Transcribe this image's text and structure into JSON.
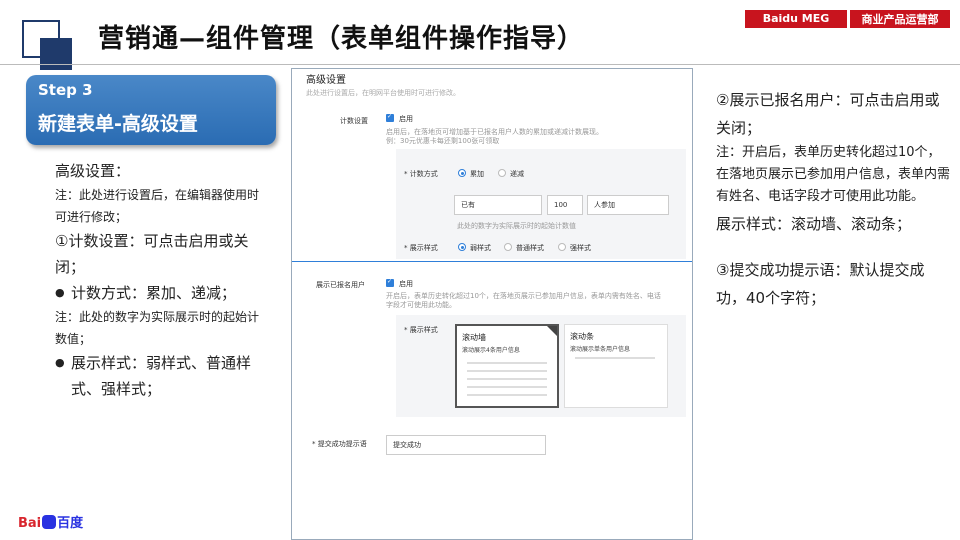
{
  "header": {
    "title": "营销通—组件管理（表单组件操作指导）",
    "tag1": "Baidu MEG",
    "tag2": "商业产品运营部"
  },
  "step": {
    "number": "Step 3",
    "title": "新建表单-高级设置"
  },
  "left_notes": {
    "l1": "高级设置：",
    "l2": "注：此处进行设置后，在编辑器使用时可进行修改；",
    "l3": "①计数设置：可点击启用或关闭；",
    "l4": "计数方式：累加、递减；",
    "l5": "注：此处的数字为实际展示时的起始计数值；",
    "l6": "展示样式：弱样式、普通样式、强样式；"
  },
  "panel": {
    "title": "高级设置",
    "subtitle": "此处进行设置后，在明网平台使用时可进行修改。",
    "count_label": "计数设置",
    "enable": "启用",
    "count_hint": "启用后，在落地页可增加基于已报名用户人数的累加或递减计数展现。",
    "count_example": "例：30元优惠卡每还剩100张可领取",
    "method_label": "* 计数方式",
    "method_opt1": "累加",
    "method_opt2": "递减",
    "input_prefix": "已有",
    "input_value": "100",
    "input_suffix": "人参加",
    "number_hint": "此处的数字为实际展示时的起始计数值",
    "style_label": "* 展示样式",
    "style_opt1": "弱样式",
    "style_opt2": "普通样式",
    "style_opt3": "强样式",
    "show_users_label": "展示已报名用户",
    "show_users_hint": "开启后，表单历史转化超过10个，在落地页展示已参加用户信息，表单内需有姓名、电话字段才可使用此功能。",
    "show_style_label": "* 展示样式",
    "card1_title": "滚动墙",
    "card1_sub": "滚动展示4条用户信息",
    "card2_title": "滚动条",
    "card2_sub": "滚动展示单条用户信息",
    "submit_label": "* 提交成功提示语",
    "submit_value": "提交成功"
  },
  "right_notes": {
    "r1": "②展示已报名用户：可点击启用或关闭；",
    "r2": "注：开启后，表单历史转化超过10个，在落地页展示已参加用户信息，表单内需有姓名、电话字段才可使用此功能。",
    "r3": "展示样式：滚动墙、滚动条；",
    "r4": "③提交成功提示语：默认提交成功，40个字符；"
  },
  "brand": {
    "left": "Bai",
    "right": "百度"
  },
  "colors": {
    "accent": "#2a6cb3",
    "brand_red": "#c8141e",
    "navy": "#1f3a6b"
  }
}
